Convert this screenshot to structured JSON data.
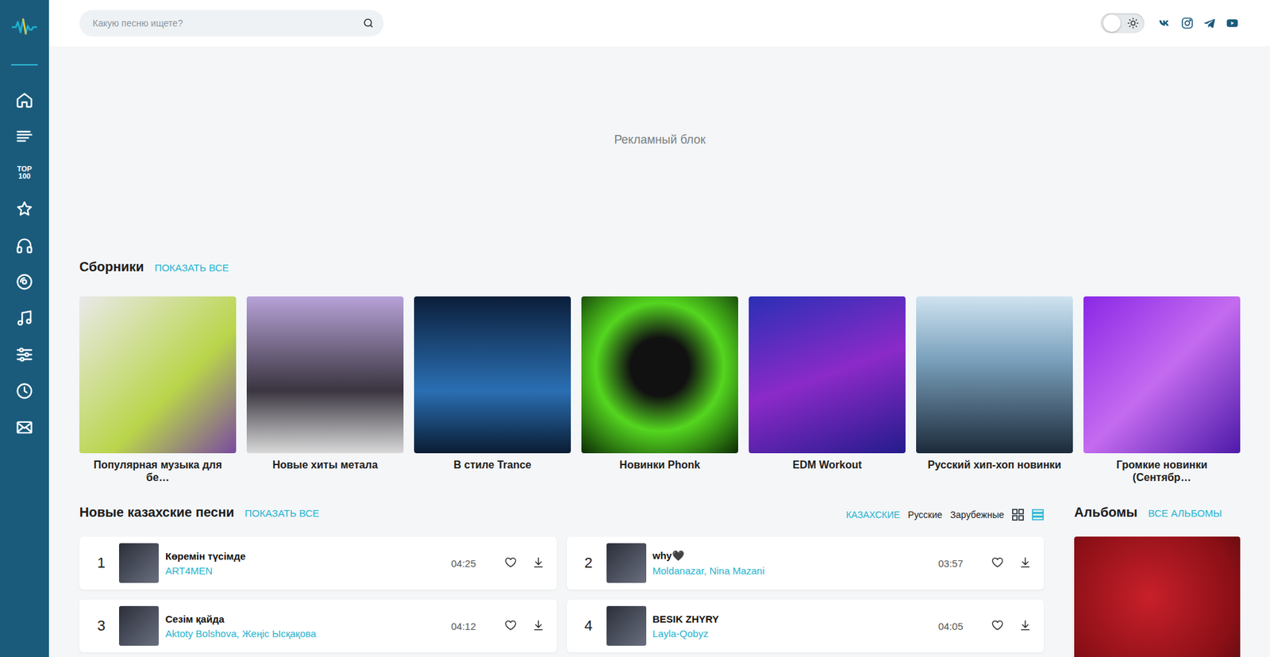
{
  "sidebar": {
    "items": [
      {
        "kind": "home"
      },
      {
        "kind": "list"
      },
      {
        "kind": "top100",
        "label": "TOP 100"
      },
      {
        "kind": "star"
      },
      {
        "kind": "headphones"
      },
      {
        "kind": "disc"
      },
      {
        "kind": "note"
      },
      {
        "kind": "sliders"
      },
      {
        "kind": "clock"
      },
      {
        "kind": "mail"
      }
    ]
  },
  "search": {
    "placeholder": "Какую песню ищете?"
  },
  "theme_toggle": {
    "on": false
  },
  "social": [
    {
      "kind": "vk"
    },
    {
      "kind": "instagram"
    },
    {
      "kind": "telegram"
    },
    {
      "kind": "youtube"
    }
  ],
  "ad": {
    "label": "Рекламный блок"
  },
  "compilations": {
    "title": "Сборники",
    "show_all": "ПОКАЗАТЬ ВСЕ",
    "items": [
      {
        "caption": "Популярная музыка для бе…"
      },
      {
        "caption": "Новые хиты метала"
      },
      {
        "caption": "В стиле Trance"
      },
      {
        "caption": "Новинки Phonk"
      },
      {
        "caption": "EDM Workout"
      },
      {
        "caption": "Русский хип-хоп новинки"
      },
      {
        "caption": "Громкие новинки (Сентябр…"
      }
    ]
  },
  "songs": {
    "title": "Новые казахские песни",
    "show_all": "ПОКАЗАТЬ ВСЕ",
    "filters": [
      {
        "label": "КАЗАХСКИЕ",
        "selected": true
      },
      {
        "label": "Русские",
        "selected": false
      },
      {
        "label": "Зарубежные",
        "selected": false
      }
    ],
    "views": [
      {
        "kind": "grid",
        "selected": false
      },
      {
        "kind": "list",
        "selected": true
      }
    ],
    "tracks": [
      {
        "number": "1",
        "title": "Көремін түсімде",
        "artists": "ART4MEN",
        "duration": "04:25"
      },
      {
        "number": "2",
        "title": "why🖤",
        "artists": "Moldanazar, Nina Mazani",
        "duration": "03:57"
      },
      {
        "number": "3",
        "title": "Сезім қайда",
        "artists": "Aktoty Bolshova, Жеңіс Ысқақова",
        "duration": "04:12"
      },
      {
        "number": "4",
        "title": "BESIK ZHYRY",
        "artists": "Layla-Qobyz",
        "duration": "04:05"
      }
    ]
  },
  "albums": {
    "title": "Альбомы",
    "show_all": "ВСЕ АЛЬБОМЫ"
  }
}
